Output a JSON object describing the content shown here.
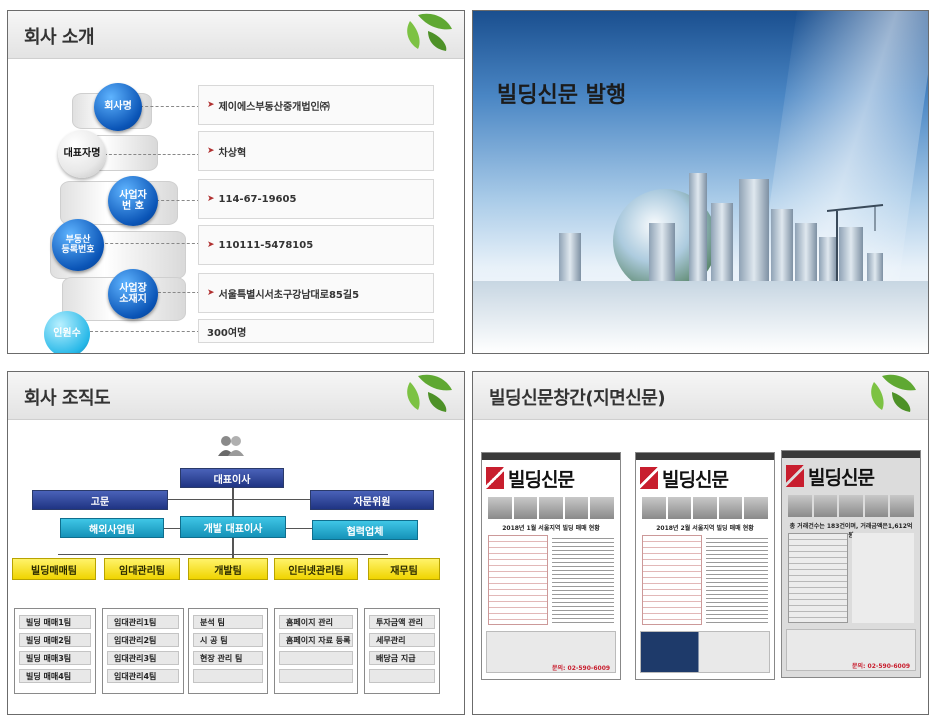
{
  "panel1": {
    "title": "회사 소개",
    "labels": [
      "회사명",
      "대표자명",
      "사업자\n번 호",
      "부동산\n등록번호",
      "사업장\n소재지",
      "인원수"
    ],
    "values": [
      "제이에스부동산중개법인㈜",
      "차상혁",
      "114-67-19605",
      "110111-5478105",
      "서울특별시서초구강남대로85길5",
      "300여명"
    ]
  },
  "panel2": {
    "title": "빌딩신문 발행"
  },
  "panel3": {
    "title": "회사 조직도",
    "ceo": "대표이사",
    "advisor": "고문",
    "consult": "자문위원",
    "overseas": "해외사업팀",
    "dev_ceo": "개발 대표이사",
    "partner": "협력업체",
    "depts": [
      "빌딩매매팀",
      "임대관리팀",
      "개발팀",
      "인터넷관리팀",
      "재무팀"
    ],
    "teams": [
      [
        "빌딩 매매1팀",
        "빌딩 매매2팀",
        "빌딩 매매3팀",
        "빌딩 매매4팀"
      ],
      [
        "임대관리1팀",
        "임대관리2팀",
        "임대관리3팀",
        "임대관리4팀"
      ],
      [
        "분석 팀",
        "시 공 팀",
        "현장 관리 팀",
        ""
      ],
      [
        "홈페이지 관리",
        "홈페이지 자료 등록",
        "",
        ""
      ],
      [
        "투자금액 관리",
        "세무관리",
        "배당금 지급",
        ""
      ]
    ]
  },
  "panel4": {
    "title": "빌딩신문창간(지면신문)",
    "papers": [
      {
        "name": "빌딩신문",
        "headline": "2018년 1월 서울지역 빌딩 매매 현황",
        "phone": "문의: 02-590-6009"
      },
      {
        "name": "빌딩신문",
        "headline": "2018년 2월 서울지역 빌딩 매매 현황",
        "phone": ""
      },
      {
        "name": "빌딩신문",
        "headline": "총 거래건수는 183건이며, 거래금액은1,612억원",
        "phone": "문의: 02-590-6009"
      }
    ]
  },
  "colors": {
    "navy": "#1f3483",
    "teal": "#1592b8",
    "yellow": "#f0d400",
    "red": "#c81e2e"
  }
}
